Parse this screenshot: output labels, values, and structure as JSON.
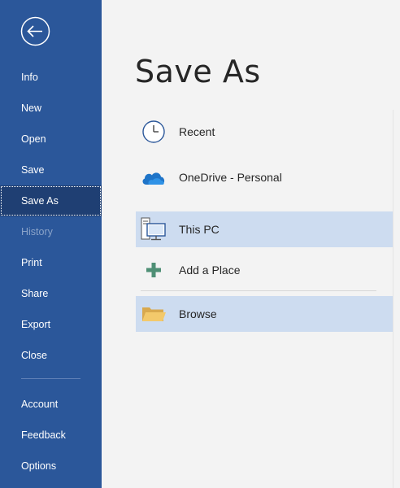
{
  "sidebar": {
    "back_icon": "back-arrow-icon",
    "items": [
      {
        "label": "Info"
      },
      {
        "label": "New"
      },
      {
        "label": "Open"
      },
      {
        "label": "Save"
      },
      {
        "label": "Save As",
        "selected": true
      },
      {
        "label": "History",
        "disabled": true
      },
      {
        "label": "Print"
      },
      {
        "label": "Share"
      },
      {
        "label": "Export"
      },
      {
        "label": "Close"
      },
      {
        "label": "Account"
      },
      {
        "label": "Feedback"
      },
      {
        "label": "Options"
      }
    ]
  },
  "main": {
    "title": "Save As",
    "locations": [
      {
        "label": "Recent",
        "icon": "clock-icon"
      },
      {
        "label": "OneDrive - Personal",
        "icon": "cloud-icon"
      },
      {
        "label": "This PC",
        "icon": "computer-icon",
        "highlighted": true
      },
      {
        "label": "Add a Place",
        "icon": "plus-icon"
      },
      {
        "label": "Browse",
        "icon": "folder-icon",
        "highlighted": true
      }
    ]
  },
  "colors": {
    "sidebar_bg": "#2b579a",
    "selected_bg": "#1f3f73",
    "highlight_bg": "#cddcf0",
    "content_bg": "#f3f3f3"
  }
}
